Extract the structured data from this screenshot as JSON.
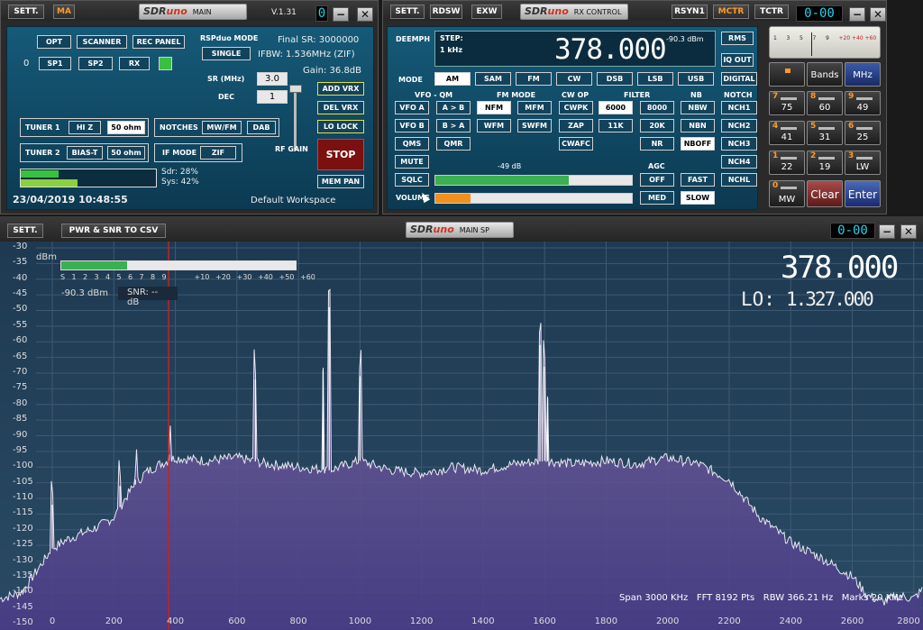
{
  "main": {
    "sett_label": "SETT.",
    "ma_label": "MA",
    "logo_text": "MAIN",
    "version": "V.1.31",
    "counter": "0",
    "opt": "OPT",
    "scanner": "SCANNER",
    "rec_panel": "REC PANEL",
    "rspduo_mode_label": "RSPduo MODE",
    "final_sr": "Final SR: 3000000",
    "channel_num": "0",
    "sp1": "SP1",
    "sp2": "SP2",
    "rx": "RX",
    "single": "SINGLE",
    "ifbw": "IFBW: 1.536MHz (ZIF)",
    "gain": "Gain: 36.8dB",
    "sr_label": "SR (MHz)",
    "sr_value": "3.0",
    "dec_label": "DEC",
    "dec_value": "1",
    "add_vrx": "ADD VRX",
    "del_vrx": "DEL VRX",
    "lo_lock": "LO LOCK",
    "tuner1": "TUNER 1",
    "hiz": "HI Z",
    "ohm1": "50 ohm",
    "notches": "NOTCHES",
    "mwfm": "MW/FM",
    "dab": "DAB",
    "rf_gain": "RF GAIN",
    "tuner2": "TUNER 2",
    "biast": "BIAS-T",
    "ohm2": "50 ohm",
    "if_mode": "IF MODE",
    "zif": "ZIF",
    "stop": "STOP",
    "sdr_load": "Sdr: 28%",
    "sys_load": "Sys: 42%",
    "mem_pan": "MEM PAN",
    "datetime": "23/04/2019 10:48:55",
    "workspace": "Default Workspace",
    "sdr_pct": 28,
    "sys_pct": 42
  },
  "rx": {
    "sett": "SETT.",
    "rdsw": "RDSW",
    "exw": "EXW",
    "logo_text": "RX CONTROL",
    "rsyn1": "RSYN1",
    "mctr": "MCTR",
    "tctr": "TCTR",
    "counter": "0-00",
    "deemph": "DEEMPH",
    "step_label": "STEP:",
    "step_value": "1 kHz",
    "frequency": "378.000",
    "level": "-90.3 dBm",
    "rms": "RMS",
    "iq_out": "IQ OUT",
    "digital": "DIGITAL",
    "mode_label": "MODE",
    "modes": [
      "AM",
      "SAM",
      "FM",
      "CW",
      "DSB",
      "LSB",
      "USB"
    ],
    "vfo_qm": "VFO - QM",
    "fm_mode": "FM MODE",
    "cw_op": "CW OP",
    "filter_label": "FILTER",
    "nb_label": "NB",
    "notch_label": "NOTCH",
    "vfoa": "VFO A",
    "atob": "A > B",
    "nfm": "NFM",
    "mfm": "MFM",
    "cwpk": "CWPK",
    "f6000": "6000",
    "f8000": "8000",
    "nbw": "NBW",
    "nch1": "NCH1",
    "vfob": "VFO B",
    "btoa": "B > A",
    "wfm": "WFM",
    "swfm": "SWFM",
    "zap": "ZAP",
    "f11k": "11K",
    "f20k": "20K",
    "nbn": "NBN",
    "nch2": "NCH2",
    "qms": "QMS",
    "qmr": "QMR",
    "cwafc": "CWAFC",
    "nr": "NR",
    "nboff": "NBOFF",
    "nch3": "NCH3",
    "mute": "MUTE",
    "signal_db": "-49 dB",
    "agc_label": "AGC",
    "nch4": "NCH4",
    "sqlc": "SQLC",
    "agc_off": "OFF",
    "agc_fast": "FAST",
    "nchl": "NCHL",
    "volume": "VOLUME",
    "agc_med": "MED",
    "agc_slow": "SLOW",
    "signal_pct": 68,
    "volume_pct": 18
  },
  "keypad": {
    "keys": [
      {
        "n": "7",
        "v": "75"
      },
      {
        "n": "8",
        "v": "60"
      },
      {
        "n": "9",
        "v": "49"
      },
      {
        "n": "4",
        "v": "41"
      },
      {
        "n": "5",
        "v": "31"
      },
      {
        "n": "6",
        "v": "25"
      },
      {
        "n": "1",
        "v": "22"
      },
      {
        "n": "2",
        "v": "19"
      },
      {
        "n": "3",
        "v": "LW"
      },
      {
        "n": "0",
        "v": "MW"
      }
    ],
    "bands": "Bands",
    "mhz": "MHz",
    "clear": "Clear",
    "enter": "Enter",
    "meter_scale": [
      "1",
      "3",
      "5",
      "7",
      "9",
      "+20",
      "+40",
      "+60"
    ]
  },
  "spectrum": {
    "sett": "SETT.",
    "csv": "PWR & SNR TO CSV",
    "logo_text": "MAIN SP",
    "counter": "0-00",
    "frequency": "378.000",
    "lo_label": "LO:",
    "lo_value": "1.327.000",
    "dbm_label": "dBm",
    "smeter_scale": [
      "S",
      "1",
      "2",
      "3",
      "4",
      "5",
      "6",
      "7",
      "8",
      "9",
      "+10",
      "+20",
      "+30",
      "+40",
      "+50",
      "+60"
    ],
    "level": "-90.3 dBm",
    "snr": "SNR: -- dB",
    "status": "Span 3000 KHz   FFT 8192 Pts   RBW 366.21 Hz   Marks 20 KHz",
    "smeter_pct": 28
  },
  "chart_data": {
    "type": "area",
    "xlabel": "",
    "ylabel": "dBm",
    "xlim": [
      -170,
      2830
    ],
    "ylim": [
      -152,
      -28
    ],
    "yticks": [
      -30,
      -35,
      -40,
      -45,
      -50,
      -55,
      -60,
      -65,
      -70,
      -75,
      -80,
      -85,
      -90,
      -95,
      -100,
      -105,
      -110,
      -115,
      -120,
      -125,
      -130,
      -135,
      -140,
      -145,
      -150
    ],
    "xticks": [
      0,
      200,
      400,
      600,
      800,
      1000,
      1200,
      1400,
      1600,
      1800,
      2000,
      2200,
      2400,
      2600,
      2800
    ],
    "marker": 378,
    "x": [
      -170,
      -100,
      -50,
      0,
      50,
      100,
      150,
      200,
      250,
      300,
      350,
      378,
      400,
      500,
      600,
      700,
      800,
      900,
      1000,
      1100,
      1200,
      1300,
      1400,
      1500,
      1600,
      1700,
      1800,
      1900,
      2000,
      2100,
      2200,
      2300,
      2400,
      2500,
      2600,
      2650,
      2700,
      2750,
      2800,
      2830
    ],
    "values": [
      -142,
      -140,
      -133,
      -126,
      -123,
      -121,
      -119,
      -116,
      -108,
      -102,
      -99,
      -98,
      -97,
      -98,
      -97,
      -99,
      -100,
      -101,
      -98,
      -101,
      -102,
      -100,
      -101,
      -99,
      -98,
      -99,
      -98,
      -99,
      -97,
      -99,
      -104,
      -116,
      -124,
      -129,
      -135,
      -141,
      -143,
      -141,
      -142,
      -139
    ],
    "peaks": [
      {
        "x": 0,
        "y": -112
      },
      {
        "x": 220,
        "y": -106
      },
      {
        "x": 270,
        "y": -104
      },
      {
        "x": 380,
        "y": -96
      },
      {
        "x": 660,
        "y": -72
      },
      {
        "x": 880,
        "y": -69
      },
      {
        "x": 900,
        "y": -49
      },
      {
        "x": 1000,
        "y": -71
      },
      {
        "x": 1585,
        "y": -61
      },
      {
        "x": 1600,
        "y": -68
      },
      {
        "x": 1610,
        "y": -78
      }
    ]
  }
}
